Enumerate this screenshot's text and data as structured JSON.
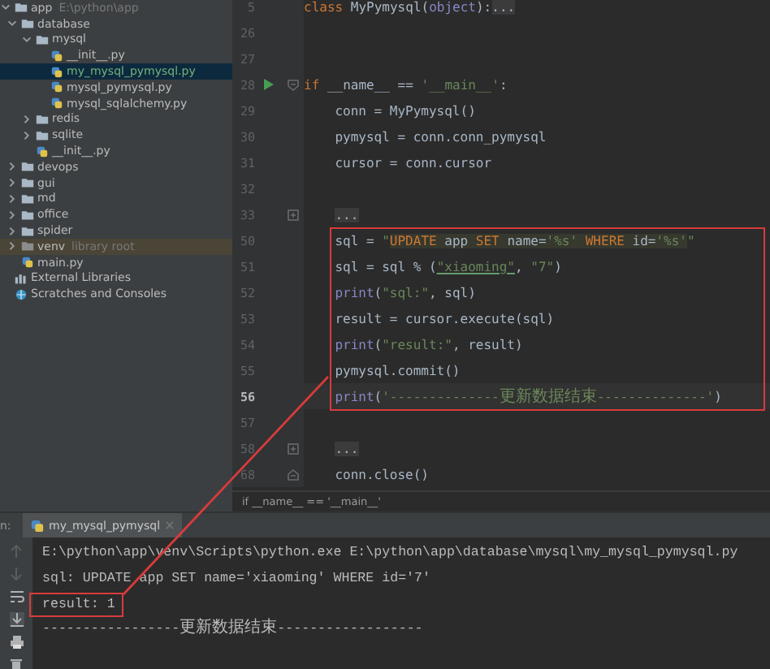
{
  "project_tree": {
    "items": [
      {
        "label": "app",
        "hint": "E:\\python\\app",
        "kind": "folder",
        "expanded": true,
        "selected": false,
        "children": [
          {
            "label": "database",
            "kind": "folder",
            "expanded": true,
            "selected": false,
            "children": [
              {
                "label": "mysql",
                "kind": "folder",
                "expanded": true,
                "selected": false,
                "children": [
                  {
                    "label": "__init__.py",
                    "kind": "python_file",
                    "selected": false
                  },
                  {
                    "label": "my_mysql_pymysql.py",
                    "kind": "python_file",
                    "selected": true
                  },
                  {
                    "label": "mysql_pymysql.py",
                    "kind": "python_file",
                    "selected": false
                  },
                  {
                    "label": "mysql_sqlalchemy.py",
                    "kind": "python_file",
                    "selected": false
                  }
                ]
              },
              {
                "label": "redis",
                "kind": "folder",
                "expanded": false,
                "selected": false
              },
              {
                "label": "sqlite",
                "kind": "folder",
                "expanded": false,
                "selected": false
              },
              {
                "label": "__init__.py",
                "kind": "python_file",
                "selected": false
              }
            ]
          },
          {
            "label": "devops",
            "kind": "folder",
            "expanded": false,
            "selected": false
          },
          {
            "label": "gui",
            "kind": "folder",
            "expanded": false,
            "selected": false
          },
          {
            "label": "md",
            "kind": "folder",
            "expanded": false,
            "selected": false
          },
          {
            "label": "office",
            "kind": "folder",
            "expanded": false,
            "selected": false
          },
          {
            "label": "spider",
            "kind": "folder",
            "expanded": false,
            "selected": false
          },
          {
            "label": "venv",
            "hint": "library root",
            "kind": "excluded_folder",
            "expanded": false,
            "selected": false
          },
          {
            "label": "main.py",
            "kind": "python_file",
            "selected": false
          }
        ]
      },
      {
        "label": "External Libraries",
        "kind": "libraries",
        "selected": false
      },
      {
        "label": "Scratches and Consoles",
        "kind": "scratches",
        "selected": false
      }
    ]
  },
  "editor": {
    "lines": [
      {
        "number": "5",
        "current": false,
        "indented": false,
        "tokens": [
          {
            "text": "class",
            "kind": "kw"
          },
          {
            "text": " MyPymysql(",
            "kind": "plain"
          },
          {
            "text": "object",
            "kind": "builtin"
          },
          {
            "text": "):",
            "kind": "plain"
          },
          {
            "text": "...",
            "kind": "fold"
          }
        ]
      },
      {
        "number": "26",
        "current": false
      },
      {
        "number": "27",
        "current": false
      },
      {
        "number": "28",
        "current": false,
        "indented": false,
        "gutter_icons": [
          {
            "kind": "run"
          },
          {
            "kind": "fold_open"
          }
        ],
        "tokens": [
          {
            "text": "if",
            "kind": "kw"
          },
          {
            "text": " __name__ == ",
            "kind": "plain"
          },
          {
            "text": "'__main__'",
            "kind": "str"
          },
          {
            "text": ":",
            "kind": "plain"
          }
        ]
      },
      {
        "number": "29",
        "current": false,
        "indented": true,
        "tokens": [
          {
            "text": "conn = MyPymysql()",
            "kind": "plain"
          }
        ]
      },
      {
        "number": "30",
        "current": false,
        "indented": true,
        "tokens": [
          {
            "text": "pymysql = conn.conn_pymysql",
            "kind": "plain"
          }
        ]
      },
      {
        "number": "31",
        "current": false,
        "indented": true,
        "tokens": [
          {
            "text": "cursor = conn.cursor",
            "kind": "plain"
          }
        ]
      },
      {
        "number": "32",
        "current": false
      },
      {
        "number": "33",
        "current": false,
        "indented": true,
        "gutter_icons": [
          {
            "kind": "fold_closed"
          }
        ],
        "tokens": [
          {
            "text": "...",
            "kind": "fold"
          }
        ]
      },
      {
        "number": "50",
        "current": false,
        "indented": true,
        "tokens": [
          {
            "text": "sql = ",
            "kind": "plain"
          },
          {
            "text": "\"",
            "kind": "str"
          },
          {
            "text": "UPDATE",
            "kind": "sqlkw"
          },
          {
            "text": " app ",
            "kind": "sqlplain"
          },
          {
            "text": "SET",
            "kind": "sqlkw"
          },
          {
            "text": " name=",
            "kind": "sqlplain"
          },
          {
            "text": "'%s'",
            "kind": "sqlstr"
          },
          {
            "text": " WHERE",
            "kind": "sqlkw"
          },
          {
            "text": " id=",
            "kind": "sqlplain"
          },
          {
            "text": "'%s'",
            "kind": "sqlstr"
          },
          {
            "text": "\"",
            "kind": "str"
          }
        ]
      },
      {
        "number": "51",
        "current": false,
        "indented": true,
        "tokens": [
          {
            "text": "sql = sql % (",
            "kind": "plain"
          },
          {
            "text": "\"xiaoming\"",
            "kind": "typo"
          },
          {
            "text": ", ",
            "kind": "plain"
          },
          {
            "text": "\"7\"",
            "kind": "str"
          },
          {
            "text": ")",
            "kind": "plain"
          }
        ]
      },
      {
        "number": "52",
        "current": false,
        "indented": true,
        "tokens": [
          {
            "text": "print",
            "kind": "builtin"
          },
          {
            "text": "(",
            "kind": "plain"
          },
          {
            "text": "\"sql:\"",
            "kind": "str"
          },
          {
            "text": ", sql)",
            "kind": "plain"
          }
        ]
      },
      {
        "number": "53",
        "current": false,
        "indented": true,
        "tokens": [
          {
            "text": "result = cursor.execute(sql)",
            "kind": "plain"
          }
        ]
      },
      {
        "number": "54",
        "current": false,
        "indented": true,
        "tokens": [
          {
            "text": "print",
            "kind": "builtin"
          },
          {
            "text": "(",
            "kind": "plain"
          },
          {
            "text": "\"result:\"",
            "kind": "str"
          },
          {
            "text": ", result)",
            "kind": "plain"
          }
        ]
      },
      {
        "number": "55",
        "current": false,
        "indented": true,
        "tokens": [
          {
            "text": "pymysql.commit()",
            "kind": "plain"
          }
        ]
      },
      {
        "number": "56",
        "current": true,
        "indented": true,
        "tokens": [
          {
            "text": "print",
            "kind": "builtin"
          },
          {
            "text": "(",
            "kind": "plain"
          },
          {
            "text": "'--------------更新数据结束--------------'",
            "kind": "str"
          },
          {
            "text": ")",
            "kind": "plain"
          }
        ]
      },
      {
        "number": "57",
        "current": false
      },
      {
        "number": "58",
        "current": false,
        "indented": true,
        "gutter_icons": [
          {
            "kind": "fold_closed"
          }
        ],
        "tokens": [
          {
            "text": "...",
            "kind": "fold"
          }
        ]
      },
      {
        "number": "68",
        "current": false,
        "indented": true,
        "gutter_icons": [
          {
            "kind": "fold_end"
          }
        ],
        "tokens": [
          {
            "text": "conn.close()",
            "kind": "plain"
          }
        ]
      }
    ],
    "breadcrumb": "if __name__ == '__main__'"
  },
  "run_panel": {
    "label": "n:",
    "tab": {
      "label": "my_mysql_pymysql",
      "selected": true
    },
    "output": [
      {
        "text": "E:\\python\\app\\venv\\Scripts\\python.exe E:\\python\\app\\database\\mysql\\my_mysql_pymysql.py",
        "boxed": false
      },
      {
        "text": "sql: UPDATE app SET name='xiaoming' WHERE id='7'",
        "boxed": false
      },
      {
        "text": "result: 1",
        "boxed": true
      },
      {
        "text": "-----------------更新数据结束------------------",
        "boxed": false
      }
    ]
  }
}
